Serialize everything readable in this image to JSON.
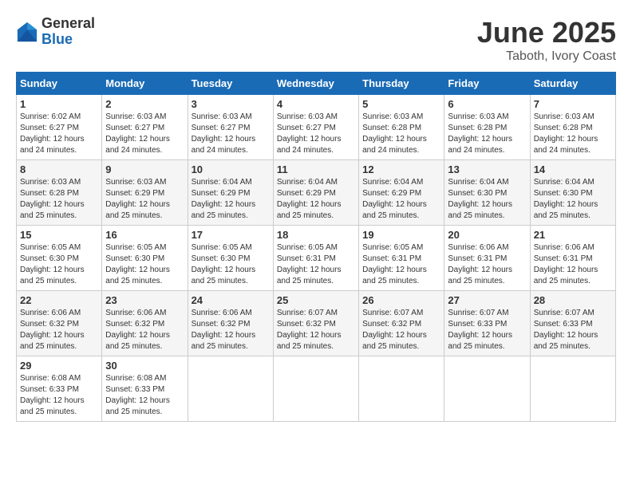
{
  "logo": {
    "general": "General",
    "blue": "Blue"
  },
  "title": {
    "month": "June 2025",
    "location": "Taboth, Ivory Coast"
  },
  "headers": [
    "Sunday",
    "Monday",
    "Tuesday",
    "Wednesday",
    "Thursday",
    "Friday",
    "Saturday"
  ],
  "weeks": [
    [
      {
        "day": "1",
        "sunrise": "6:02 AM",
        "sunset": "6:27 PM",
        "daylight": "12 hours and 24 minutes."
      },
      {
        "day": "2",
        "sunrise": "6:03 AM",
        "sunset": "6:27 PM",
        "daylight": "12 hours and 24 minutes."
      },
      {
        "day": "3",
        "sunrise": "6:03 AM",
        "sunset": "6:27 PM",
        "daylight": "12 hours and 24 minutes."
      },
      {
        "day": "4",
        "sunrise": "6:03 AM",
        "sunset": "6:27 PM",
        "daylight": "12 hours and 24 minutes."
      },
      {
        "day": "5",
        "sunrise": "6:03 AM",
        "sunset": "6:28 PM",
        "daylight": "12 hours and 24 minutes."
      },
      {
        "day": "6",
        "sunrise": "6:03 AM",
        "sunset": "6:28 PM",
        "daylight": "12 hours and 24 minutes."
      },
      {
        "day": "7",
        "sunrise": "6:03 AM",
        "sunset": "6:28 PM",
        "daylight": "12 hours and 24 minutes."
      }
    ],
    [
      {
        "day": "8",
        "sunrise": "6:03 AM",
        "sunset": "6:28 PM",
        "daylight": "12 hours and 25 minutes."
      },
      {
        "day": "9",
        "sunrise": "6:03 AM",
        "sunset": "6:29 PM",
        "daylight": "12 hours and 25 minutes."
      },
      {
        "day": "10",
        "sunrise": "6:04 AM",
        "sunset": "6:29 PM",
        "daylight": "12 hours and 25 minutes."
      },
      {
        "day": "11",
        "sunrise": "6:04 AM",
        "sunset": "6:29 PM",
        "daylight": "12 hours and 25 minutes."
      },
      {
        "day": "12",
        "sunrise": "6:04 AM",
        "sunset": "6:29 PM",
        "daylight": "12 hours and 25 minutes."
      },
      {
        "day": "13",
        "sunrise": "6:04 AM",
        "sunset": "6:30 PM",
        "daylight": "12 hours and 25 minutes."
      },
      {
        "day": "14",
        "sunrise": "6:04 AM",
        "sunset": "6:30 PM",
        "daylight": "12 hours and 25 minutes."
      }
    ],
    [
      {
        "day": "15",
        "sunrise": "6:05 AM",
        "sunset": "6:30 PM",
        "daylight": "12 hours and 25 minutes."
      },
      {
        "day": "16",
        "sunrise": "6:05 AM",
        "sunset": "6:30 PM",
        "daylight": "12 hours and 25 minutes."
      },
      {
        "day": "17",
        "sunrise": "6:05 AM",
        "sunset": "6:30 PM",
        "daylight": "12 hours and 25 minutes."
      },
      {
        "day": "18",
        "sunrise": "6:05 AM",
        "sunset": "6:31 PM",
        "daylight": "12 hours and 25 minutes."
      },
      {
        "day": "19",
        "sunrise": "6:05 AM",
        "sunset": "6:31 PM",
        "daylight": "12 hours and 25 minutes."
      },
      {
        "day": "20",
        "sunrise": "6:06 AM",
        "sunset": "6:31 PM",
        "daylight": "12 hours and 25 minutes."
      },
      {
        "day": "21",
        "sunrise": "6:06 AM",
        "sunset": "6:31 PM",
        "daylight": "12 hours and 25 minutes."
      }
    ],
    [
      {
        "day": "22",
        "sunrise": "6:06 AM",
        "sunset": "6:32 PM",
        "daylight": "12 hours and 25 minutes."
      },
      {
        "day": "23",
        "sunrise": "6:06 AM",
        "sunset": "6:32 PM",
        "daylight": "12 hours and 25 minutes."
      },
      {
        "day": "24",
        "sunrise": "6:06 AM",
        "sunset": "6:32 PM",
        "daylight": "12 hours and 25 minutes."
      },
      {
        "day": "25",
        "sunrise": "6:07 AM",
        "sunset": "6:32 PM",
        "daylight": "12 hours and 25 minutes."
      },
      {
        "day": "26",
        "sunrise": "6:07 AM",
        "sunset": "6:32 PM",
        "daylight": "12 hours and 25 minutes."
      },
      {
        "day": "27",
        "sunrise": "6:07 AM",
        "sunset": "6:33 PM",
        "daylight": "12 hours and 25 minutes."
      },
      {
        "day": "28",
        "sunrise": "6:07 AM",
        "sunset": "6:33 PM",
        "daylight": "12 hours and 25 minutes."
      }
    ],
    [
      {
        "day": "29",
        "sunrise": "6:08 AM",
        "sunset": "6:33 PM",
        "daylight": "12 hours and 25 minutes."
      },
      {
        "day": "30",
        "sunrise": "6:08 AM",
        "sunset": "6:33 PM",
        "daylight": "12 hours and 25 minutes."
      },
      null,
      null,
      null,
      null,
      null
    ]
  ]
}
